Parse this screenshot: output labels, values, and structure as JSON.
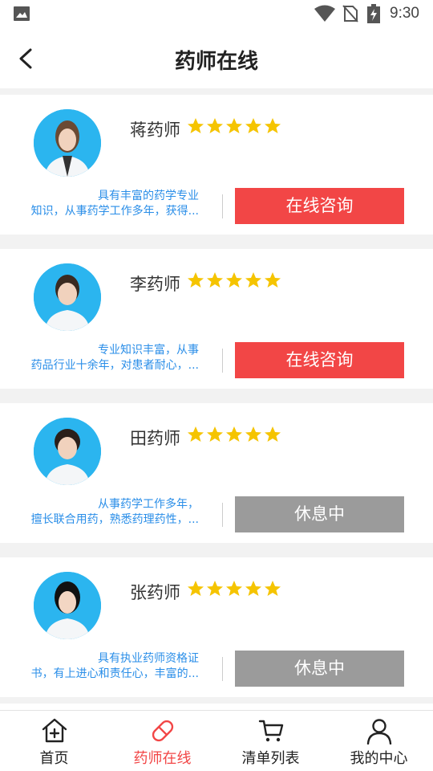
{
  "status_bar": {
    "time": "9:30"
  },
  "header": {
    "title": "药师在线"
  },
  "pharmacists": [
    {
      "name": "蒋药师",
      "rating": 5,
      "desc_line1": "具有丰富的药学专业",
      "desc_line2": "知识，从事药学工作多年，获得...",
      "status": "在线咨询",
      "online": true
    },
    {
      "name": "李药师",
      "rating": 5,
      "desc_line1": "专业知识丰富，从事",
      "desc_line2": "药品行业十余年，对患者耐心，...",
      "status": "在线咨询",
      "online": true
    },
    {
      "name": "田药师",
      "rating": 5,
      "desc_line1": "从事药学工作多年，",
      "desc_line2": "擅长联合用药，熟悉药理药性，...",
      "status": "休息中",
      "online": false
    },
    {
      "name": "张药师",
      "rating": 5,
      "desc_line1": "具有执业药师资格证",
      "desc_line2": "书，有上进心和责任心，丰富的...",
      "status": "休息中",
      "online": false
    }
  ],
  "tabbar": [
    {
      "label": "首页",
      "icon": "home-icon",
      "active": false
    },
    {
      "label": "药师在线",
      "icon": "pill-icon",
      "active": true
    },
    {
      "label": "清单列表",
      "icon": "cart-icon",
      "active": false
    },
    {
      "label": "我的中心",
      "icon": "user-icon",
      "active": false
    }
  ],
  "colors": {
    "accent": "#f24646",
    "offline": "#9b9b9b",
    "link": "#2a8ee8",
    "avatar_bg": "#2bb5ef",
    "star": "#f5c400"
  }
}
